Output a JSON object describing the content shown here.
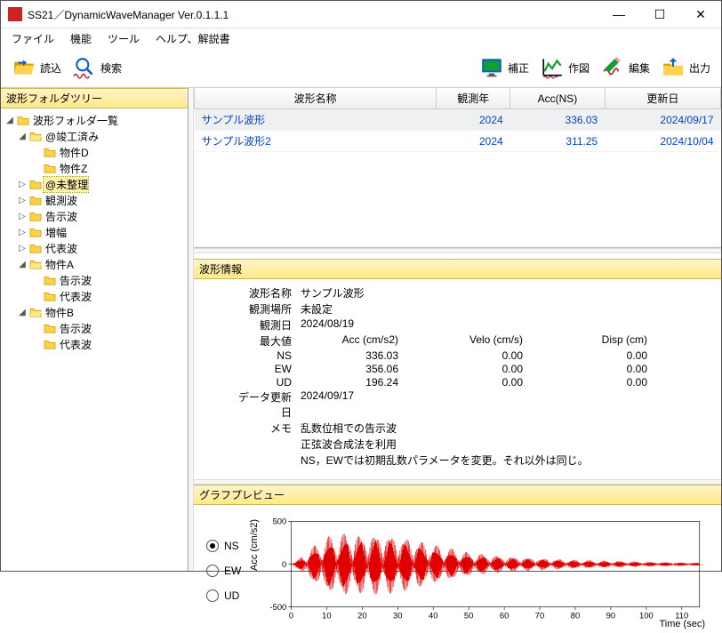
{
  "window": {
    "title": "SS21／DynamicWaveManager Ver.0.1.1.1"
  },
  "menu": {
    "file": "ファイル",
    "function": "機能",
    "tool": "ツール",
    "help": "ヘルプ、解説書"
  },
  "toolbar": {
    "load": "読込",
    "search": "検索",
    "correct": "補正",
    "plot": "作図",
    "edit": "編集",
    "output": "出力"
  },
  "sidebar": {
    "header": "波形フォルダツリー",
    "root": "波形フォルダ一覧",
    "items": {
      "completed": "@竣工済み",
      "bukkenD": "物件D",
      "bukkenZ": "物件Z",
      "unsorted": "@未整理",
      "observed": "観測波",
      "notice": "告示波",
      "amplified": "増幅",
      "representative": "代表波",
      "bukkenA": "物件A",
      "notice2": "告示波",
      "rep2": "代表波",
      "bukkenB": "物件B",
      "notice3": "告示波",
      "rep3": "代表波"
    }
  },
  "table": {
    "headers": {
      "name": "波形名称",
      "year": "観測年",
      "acc": "Acc(NS)",
      "updated": "更新日"
    },
    "rows": [
      {
        "name": "サンプル波形",
        "year": "2024",
        "acc": "336.03",
        "updated": "2024/09/17"
      },
      {
        "name": "サンプル波形2",
        "year": "2024",
        "acc": "311.25",
        "updated": "2024/10/04"
      }
    ]
  },
  "info": {
    "header": "波形情報",
    "labels": {
      "name": "波形名称",
      "place": "観測場所",
      "date": "観測日",
      "max": "最大値",
      "ns": "NS",
      "ew": "EW",
      "ud": "UD",
      "updated": "データ更新日",
      "memo": "メモ",
      "accH": "Acc (cm/s2)",
      "veloH": "Velo (cm/s)",
      "dispH": "Disp (cm)"
    },
    "values": {
      "name": "サンプル波形",
      "place": "未設定",
      "date": "2024/08/19",
      "ns": {
        "acc": "336.03",
        "velo": "0.00",
        "disp": "0.00"
      },
      "ew": {
        "acc": "356.06",
        "velo": "0.00",
        "disp": "0.00"
      },
      "ud": {
        "acc": "196.24",
        "velo": "0.00",
        "disp": "0.00"
      },
      "updated": "2024/09/17",
      "memo1": "乱数位相での告示波",
      "memo2": "正弦波合成法を利用",
      "memo3": "NS，EWでは初期乱数パラメータを変更。それ以外は同じ。"
    }
  },
  "graph": {
    "header": "グラフプレビュー",
    "radios": {
      "ns": "NS",
      "ew": "EW",
      "ud": "UD"
    },
    "ylabel": "Acc (cm/s2)",
    "xlabel": "Time (sec)",
    "yticks": {
      "top": "500",
      "mid": "0",
      "bot": "-500"
    },
    "xticks": [
      "0",
      "10",
      "20",
      "30",
      "40",
      "50",
      "60",
      "70",
      "80",
      "90",
      "100",
      "110"
    ]
  },
  "chart_data": {
    "type": "line",
    "title": "",
    "xlabel": "Time (sec)",
    "ylabel": "Acc (cm/s2)",
    "xlim": [
      0,
      115
    ],
    "ylim": [
      -500,
      500
    ],
    "series": [
      {
        "name": "NS",
        "note": "seismic accelerogram; dense oscillation, envelope approximated",
        "envelope_t": [
          0,
          2,
          5,
          10,
          15,
          20,
          25,
          30,
          35,
          40,
          50,
          60,
          70,
          80,
          90,
          100,
          110,
          115
        ],
        "envelope_amp": [
          0,
          50,
          150,
          280,
          320,
          300,
          310,
          290,
          250,
          200,
          120,
          80,
          60,
          45,
          35,
          25,
          18,
          15
        ]
      }
    ]
  }
}
